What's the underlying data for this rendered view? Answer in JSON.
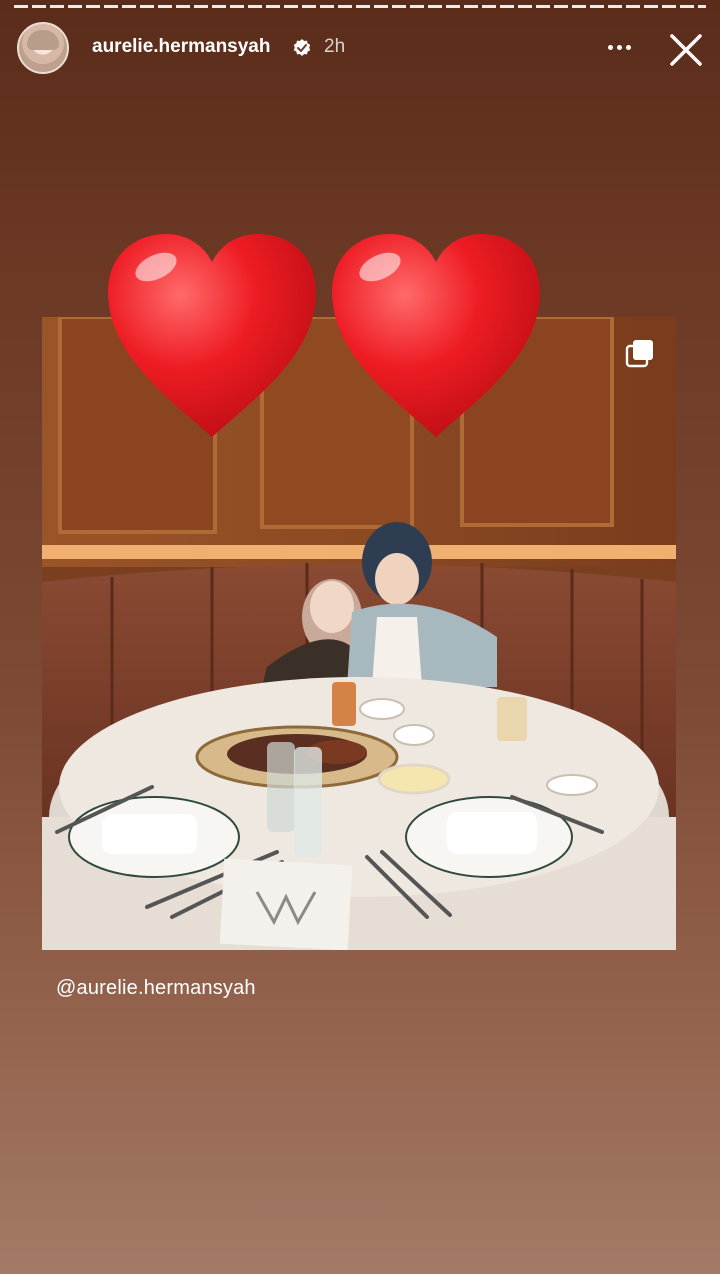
{
  "story": {
    "progress_segments": 1,
    "username": "aurelie.hermansyah",
    "time_ago": "2h",
    "verified": true,
    "mention": "@aurelie.hermansyah"
  },
  "icons": {
    "avatar": "profile-avatar",
    "verified": "verified-badge-icon",
    "more": "more-options-icon",
    "close": "close-icon",
    "multi": "multiple-photos-icon",
    "sticker": "red-heart-emoji"
  },
  "colors": {
    "background_top": "#5a2c1a",
    "background_bottom": "#a47a66",
    "heart": "#e0141c",
    "text": "#ffffff"
  }
}
